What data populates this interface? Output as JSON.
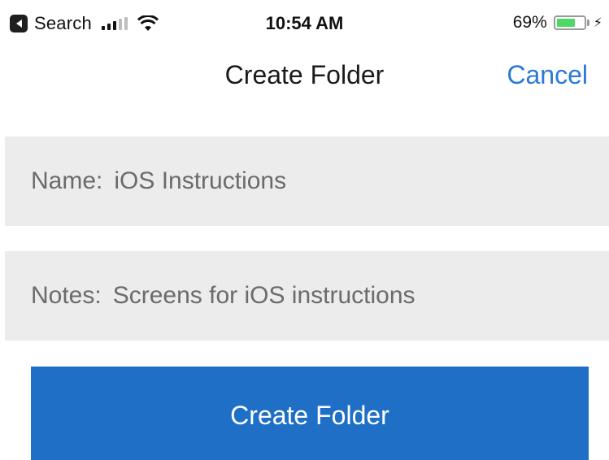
{
  "status_bar": {
    "back_app_label": "Search",
    "back_app_icon": "app-back-icon",
    "signal_icon": "cellular-signal-icon",
    "wifi_icon": "wifi-icon",
    "time": "10:54 AM",
    "battery_percent_text": "69%",
    "battery_level": 0.69,
    "battery_color": "#4cd964",
    "charging_icon": "lightning-bolt-icon"
  },
  "nav_bar": {
    "title": "Create Folder",
    "cancel_label": "Cancel",
    "accent_color": "#2a7ad6"
  },
  "form": {
    "name_label": "Name:",
    "name_value": "iOS Instructions",
    "notes_label": "Notes:",
    "notes_value": "Screens for iOS instructions",
    "field_background": "#ececec"
  },
  "actions": {
    "create_label": "Create Folder",
    "button_color": "#1f6fc7"
  }
}
